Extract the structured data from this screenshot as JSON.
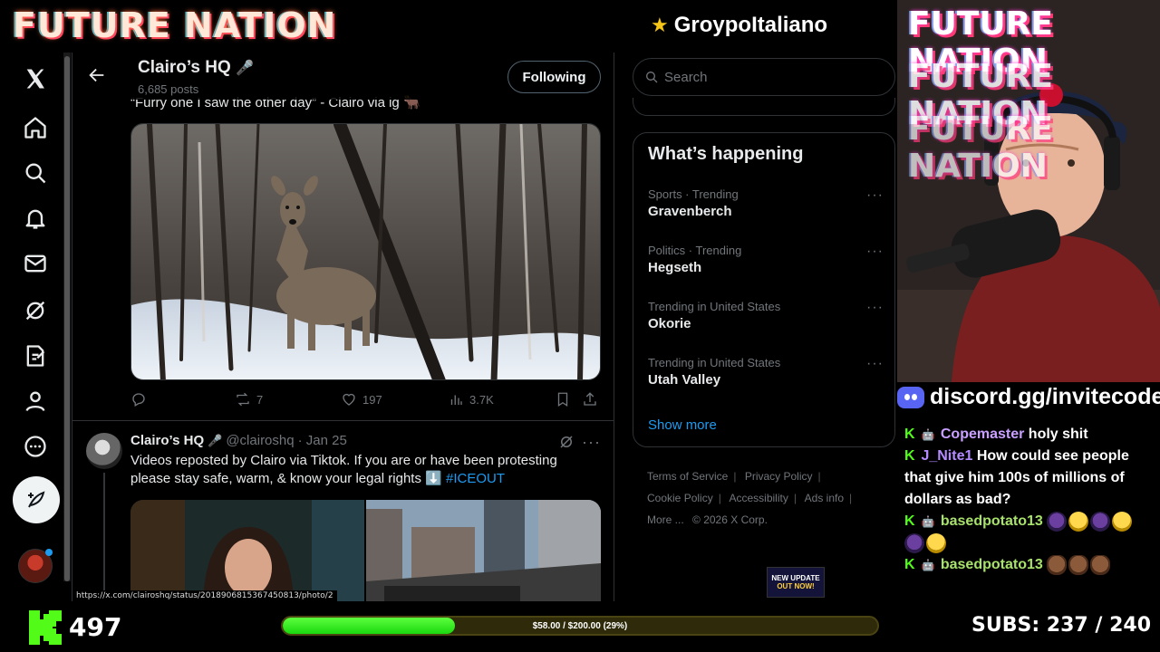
{
  "overlay": {
    "brand": "FUTURE NATION",
    "streamer_name": "GroypoItaliano",
    "follower_count": "497",
    "goal": {
      "label": "$58.00 / $200.00 (29%)",
      "progress": 0.29
    },
    "subs_label": "SUBS:",
    "subs_value": "237 / 240"
  },
  "nav": {
    "items": [
      "x-logo",
      "home",
      "explore",
      "notifications",
      "messages",
      "grok",
      "communities",
      "profile",
      "more"
    ]
  },
  "profile": {
    "name": "Clairo’s HQ",
    "posts": "6,685 posts",
    "follow_label": "Following"
  },
  "post1": {
    "caption": "“Furry one I saw the other day” - Clairo via ig 🐂",
    "replies": "",
    "reposts": "7",
    "likes": "197",
    "views": "3.7K"
  },
  "post2": {
    "name": "Clairo’s HQ",
    "handle": "@clairoshq",
    "date": "· Jan 25",
    "text": "Videos reposted by Clairo via Tiktok. If you are or have been protesting please stay safe, warm, & know your legal rights ⬇️",
    "hashtag": "#ICEOUT"
  },
  "status_url": "https://x.com/clairoshq/status/2018906815367450813/photo/2",
  "sidebar": {
    "search_placeholder": "Search",
    "trends_title": "What’s happening",
    "trends": [
      {
        "meta": "Sports · Trending",
        "name": "Gravenberch"
      },
      {
        "meta": "Politics · Trending",
        "name": "Hegseth"
      },
      {
        "meta": "Trending in United States",
        "name": "Okorie"
      },
      {
        "meta": "Trending in United States",
        "name": "Utah Valley"
      }
    ],
    "show_more": "Show more",
    "footer": {
      "terms": "Terms of Service",
      "privacy": "Privacy Policy",
      "cookie": "Cookie Policy",
      "accessibility": "Accessibility",
      "ads": "Ads info",
      "more": "More ...",
      "copyright": "© 2026 X Corp."
    },
    "mini_card": {
      "line1": "NEW UPDATE",
      "line2": "OUT NOW!"
    }
  },
  "chat": {
    "discord": "discord.gg/invitecode",
    "messages": [
      {
        "user": "Copemaster",
        "text": "holy shit"
      },
      {
        "user": "J_Nite1",
        "text": "How could see people that give him 100s of millions of dollars as bad?"
      },
      {
        "user": "basedpotato13",
        "text": ""
      },
      {
        "user": "basedpotato13",
        "text": ""
      }
    ]
  },
  "colors": {
    "x_blue": "#1d9bf0",
    "kick_green": "#53fc18",
    "muted": "#71767b"
  }
}
